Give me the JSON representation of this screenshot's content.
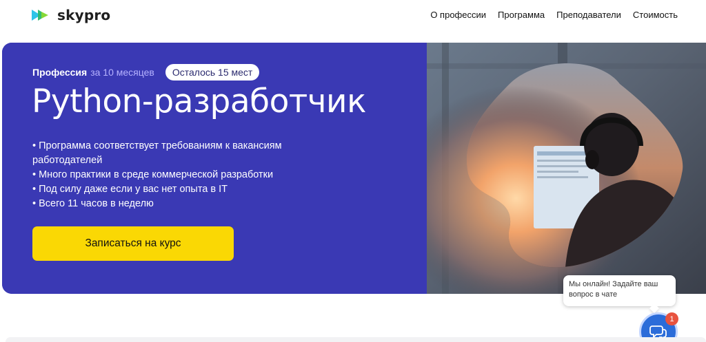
{
  "header": {
    "logo_text": "skypro",
    "logo_icon": "play-triangles-icon",
    "nav": [
      {
        "label": "О профессии"
      },
      {
        "label": "Программа"
      },
      {
        "label": "Преподаватели"
      },
      {
        "label": "Стоимость"
      }
    ]
  },
  "hero": {
    "profession_label": "Профессия",
    "duration_label": "за 10 месяцев",
    "seats_badge": "Осталось 15 мест",
    "title": "Python-разработчик",
    "features": [
      "• Программа соответствует требованиям к вакансиям работодателей",
      "• Много практики в среде коммерческой разработки",
      "• Под силу даже если у вас нет опыта в IT",
      "• Всего 11 часов в неделю"
    ],
    "cta_label": "Записаться на курс",
    "photo": "person-with-headphones-at-laptop-image"
  },
  "chat": {
    "bubble_text": "Мы онлайн! Задайте ваш вопрос в чате",
    "unread_count": "1",
    "icon": "chat-bubbles-icon"
  },
  "colors": {
    "hero_background": "#3a39b4",
    "cta_background": "#fad804",
    "duration_text": "#b6b2ff",
    "chat_button": "#2b6cd9",
    "chat_badge": "#e8533f"
  }
}
